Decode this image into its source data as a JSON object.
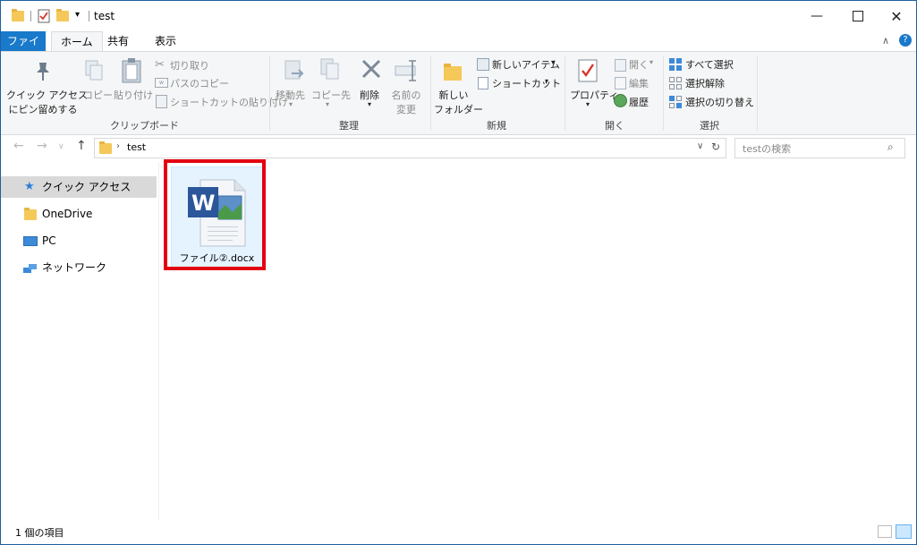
{
  "window": {
    "title": "test",
    "min_icon": "minimize-icon",
    "max_icon": "maximize-icon",
    "close_icon": "close-icon"
  },
  "tabs": {
    "file": "ファイル",
    "home": "ホーム",
    "share": "共有",
    "view": "表示"
  },
  "ribbon": {
    "clipboard": {
      "pin_line1": "クイック アクセス",
      "pin_line2": "にピン留めする",
      "copy": "コピー",
      "paste": "貼り付け",
      "cut": "切り取り",
      "copy_path": "パスのコピー",
      "paste_shortcut": "ショートカットの貼り付け",
      "group_label": "クリップボード"
    },
    "organize": {
      "move_to": "移動先",
      "copy_to": "コピー先",
      "delete": "削除",
      "rename_line1": "名前の",
      "rename_line2": "変更",
      "group_label": "整理"
    },
    "new": {
      "new_folder_line1": "新しい",
      "new_folder_line2": "フォルダー",
      "new_item": "新しいアイテム",
      "easy_access": "ショートカット",
      "group_label": "新規"
    },
    "open": {
      "properties": "プロパティ",
      "open": "開く",
      "edit": "編集",
      "history": "履歴",
      "group_label": "開く"
    },
    "select": {
      "select_all": "すべて選択",
      "select_none": "選択解除",
      "invert": "選択の切り替え",
      "group_label": "選択"
    }
  },
  "address": {
    "crumb": "test",
    "search_placeholder": "testの検索"
  },
  "nav": {
    "quick_access": "クイック アクセス",
    "onedrive": "OneDrive",
    "pc": "PC",
    "network": "ネットワーク"
  },
  "files": [
    {
      "name": "ファイル②.docx",
      "icon": "word-document-icon"
    }
  ],
  "status": {
    "count": "1 個の項目"
  },
  "colors": {
    "accent": "#1979ca",
    "highlight": "#e30011"
  }
}
